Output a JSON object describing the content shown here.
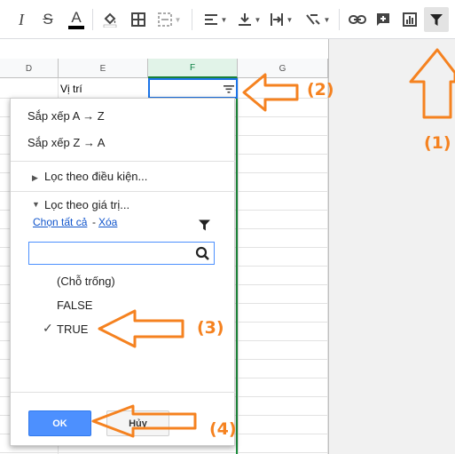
{
  "toolbar": {
    "italic_label": "I",
    "strike_label": "S",
    "text_color_label": "A",
    "active_tool": "filter-icon"
  },
  "columns": [
    "D",
    "E",
    "F",
    "G"
  ],
  "selected_column": "F",
  "cells": {
    "e1": "Vị trí"
  },
  "filter_menu": {
    "sort_az": "Sắp xếp A → Z",
    "sort_za": "Sắp xếp Z → A",
    "filter_by_condition": "Lọc theo điều kiện...",
    "filter_by_values": "Lọc theo giá trị...",
    "select_all": "Chọn tất cả",
    "link_separator": "-",
    "clear": "Xóa",
    "search_placeholder": "",
    "values": [
      {
        "label": "(Chỗ trống)",
        "checked": false
      },
      {
        "label": "FALSE",
        "checked": false
      },
      {
        "label": "TRUE",
        "checked": true
      }
    ],
    "check_mark": "✓",
    "ok_label": "OK",
    "cancel_label": "Hủy"
  },
  "annotations": {
    "step1": "(1)",
    "step2": "(2)",
    "step3": "(3)",
    "step4": "(4)",
    "arrow_color": "#f58220"
  },
  "colors": {
    "accent_blue": "#4d90fe",
    "selected_green": "#1e8e3e"
  }
}
